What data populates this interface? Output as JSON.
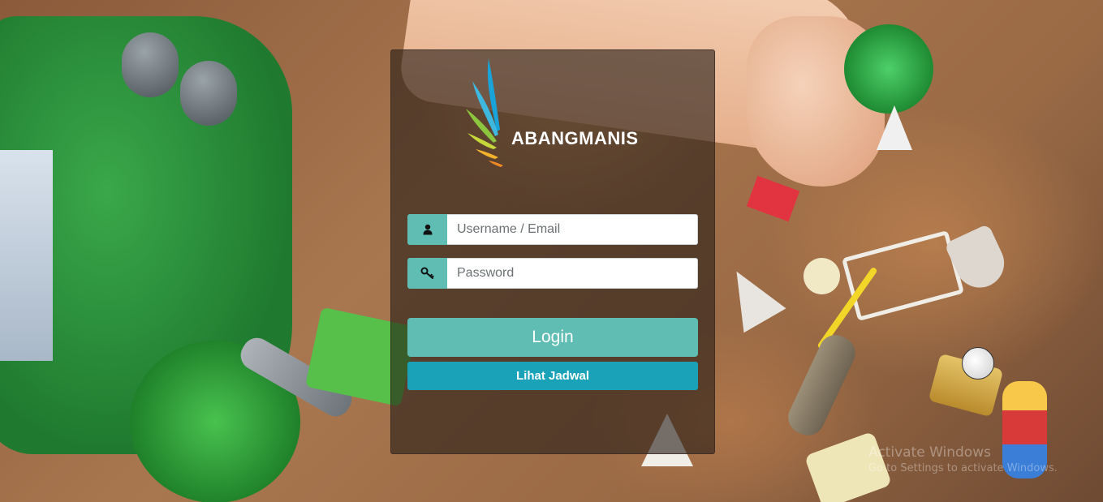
{
  "brand": {
    "name": "ABANGMANIS",
    "logo_colors": [
      "#1aa3d9",
      "#3fb8e0",
      "#8cc63f",
      "#c6d83a",
      "#f2b22c",
      "#f08a24"
    ]
  },
  "login_form": {
    "username_placeholder": "Username / Email",
    "password_placeholder": "Password",
    "username_icon": "user-icon",
    "password_icon": "key-icon",
    "login_label": "Login",
    "schedule_label": "Lihat Jadwal"
  },
  "colors": {
    "addon": "#5fbdb3",
    "login_button": "#5fbdb3",
    "schedule_button": "#19a2b8",
    "panel_overlay": "rgba(40,30,24,0.62)"
  },
  "os_watermark": {
    "title": "Activate Windows",
    "subtitle": "Go to Settings to activate Windows."
  }
}
